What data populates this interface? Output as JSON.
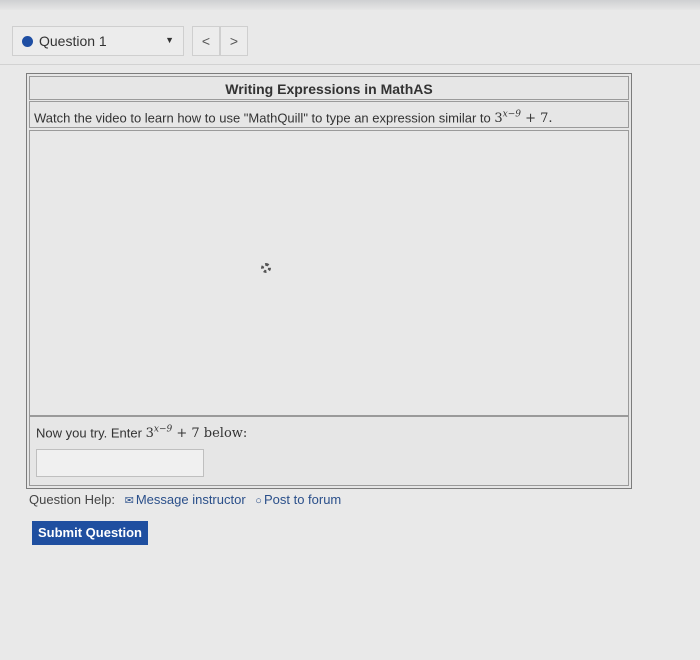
{
  "nav": {
    "question_label": "Question 1",
    "prev": "<",
    "next": ">"
  },
  "question": {
    "title": "Writing Expressions in MathAS",
    "instruction_text": "Watch the video to learn how to use \"MathQuill\" to type an expression similar to",
    "expr_base": "3",
    "expr_exp": "x−9",
    "expr_tail": "+ 7.",
    "try_text": "Now you try. Enter",
    "try_tail": "+ 7 below:",
    "answer_value": ""
  },
  "help": {
    "label": "Question Help:",
    "message": "Message instructor",
    "forum": "Post to forum"
  },
  "submit_label": "Submit Question",
  "colors": {
    "accent": "#1f4fa0",
    "dot": "#1e4ea3"
  }
}
